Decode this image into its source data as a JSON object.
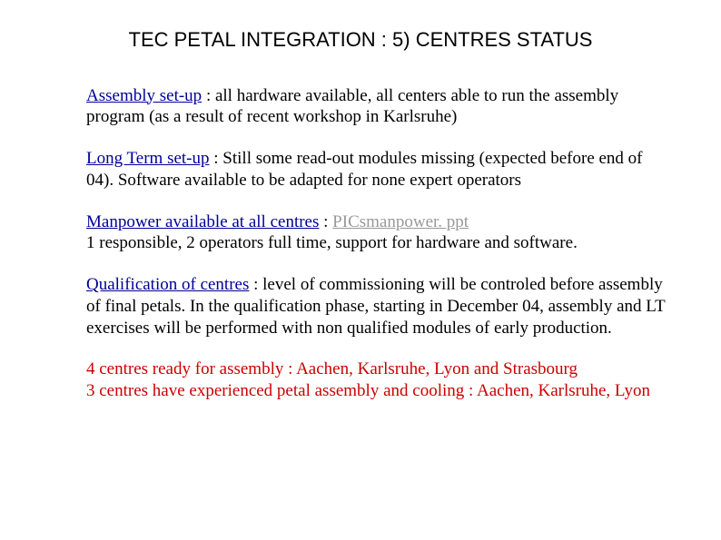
{
  "title": "TEC PETAL INTEGRATION : 5) CENTRES STATUS",
  "p1": {
    "lead": "Assembly set-up",
    "rest": " : all hardware available, all centers able to run the assembly program (as a result of recent workshop in Karlsruhe)"
  },
  "p2": {
    "lead": "Long Term set-up",
    "rest": " : Still some read-out modules missing (expected before end of 04). Software available to be adapted for none expert operators"
  },
  "p3": {
    "lead": "Manpower available at all centres",
    "colon": " : ",
    "link": "PICsmanpower. ppt",
    "rest": " 1 responsible, 2 operators full time, support for hardware and software."
  },
  "p4": {
    "lead": "Qualification of centres",
    "rest": " : level of commissioning  will be controled before assembly of final petals. In the qualification phase, starting in December 04, assembly and LT exercises will be performed with non qualified modules of early production."
  },
  "p5a": "4 centres ready for assembly : Aachen, Karlsruhe, Lyon and Strasbourg",
  "p5b": "3 centres have experienced petal assembly and cooling : Aachen, Karlsruhe, Lyon"
}
